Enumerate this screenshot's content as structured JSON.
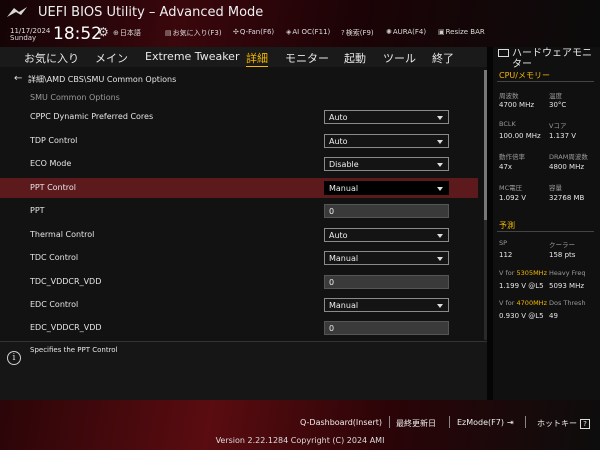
{
  "header": {
    "title": "UEFI BIOS Utility – Advanced Mode",
    "date": "11/17/2024",
    "day": "Sunday",
    "time": "18:52",
    "tools": [
      {
        "label": "日本語",
        "icon": "globe-icon"
      },
      {
        "label": "お気に入り(F3)",
        "icon": "favorites-icon"
      },
      {
        "label": "Q-Fan(F6)",
        "icon": "fan-icon"
      },
      {
        "label": "AI OC(F11)",
        "icon": "ai-oc-icon"
      },
      {
        "label": "検索(F9)",
        "icon": "search-icon"
      },
      {
        "label": "AURA(F4)",
        "icon": "aura-icon"
      },
      {
        "label": "Resize BAR",
        "icon": "resize-bar-icon"
      }
    ]
  },
  "menu": {
    "items": [
      "お気に入り",
      "メイン",
      "Extreme Tweaker",
      "詳細",
      "モニター",
      "起動",
      "ツール",
      "終了"
    ],
    "active": "詳細"
  },
  "main": {
    "breadcrumb": "詳細\\AMD CBS\\SMU Common Options",
    "section": "SMU Common Options",
    "rows": [
      {
        "label": "CPPC Dynamic Preferred Cores",
        "value": "Auto",
        "type": "select"
      },
      {
        "label": "TDP Control",
        "value": "Auto",
        "type": "select"
      },
      {
        "label": "ECO Mode",
        "value": "Disable",
        "type": "select"
      },
      {
        "label": "PPT Control",
        "value": "Manual",
        "type": "select",
        "highlight": true
      },
      {
        "label": "PPT",
        "value": "0",
        "type": "input"
      },
      {
        "label": "Thermal Control",
        "value": "Auto",
        "type": "select"
      },
      {
        "label": "TDC Control",
        "value": "Manual",
        "type": "select"
      },
      {
        "label": "TDC_VDDCR_VDD",
        "value": "0",
        "type": "input"
      },
      {
        "label": "EDC Control",
        "value": "Manual",
        "type": "select"
      },
      {
        "label": "EDC_VDDCR_VDD",
        "value": "0",
        "type": "input"
      }
    ]
  },
  "help": {
    "text": "Specifies the PPT Control"
  },
  "hardware": {
    "title": "ハードウェアモニター",
    "cpu_section": "CPU/メモリー",
    "cpu": {
      "freq_label": "周波数",
      "freq_value": "4700 MHz",
      "temp_label": "温度",
      "temp_value": "30°C",
      "bclk_label": "BCLK",
      "bclk_value": "100.00 MHz",
      "vcore_label": "Vコア",
      "vcore_value": "1.137 V",
      "ratio_label": "動作倍率",
      "ratio_value": "47x",
      "dram_label": "DRAM周波数",
      "dram_value": "4800 MHz",
      "mc_label": "MC電圧",
      "mc_value": "1.092 V",
      "cap_label": "容量",
      "cap_value": "32768 MB"
    },
    "predict_section": "予測",
    "predict": {
      "sp_label": "SP",
      "sp_value": "112",
      "cooler_label": "クーラー",
      "cooler_value": "158 pts",
      "vfor1_prefix": "V for ",
      "vfor1_freq": "5305MHz",
      "vfor1_value": "1.199 V @L5",
      "heavy_label": "Heavy Freq",
      "heavy_value": "5093 MHz",
      "vfor2_prefix": "V for ",
      "vfor2_freq": "4700MHz",
      "vfor2_value": "0.930 V @L5",
      "dos_label": "Dos Thresh",
      "dos_value": "49"
    }
  },
  "footer": {
    "qdash": "Q-Dashboard(Insert)",
    "last_modified": "最終更新日",
    "ezmode": "EzMode(F7)",
    "hotkey": "ホットキー",
    "hotkey_badge": "?",
    "version": "Version 2.22.1284 Copyright (C) 2024 AMI"
  },
  "colors": {
    "accent": "#f5b700",
    "highlight_row": "#5c1a1c",
    "red_glow": "#5a0c10"
  }
}
